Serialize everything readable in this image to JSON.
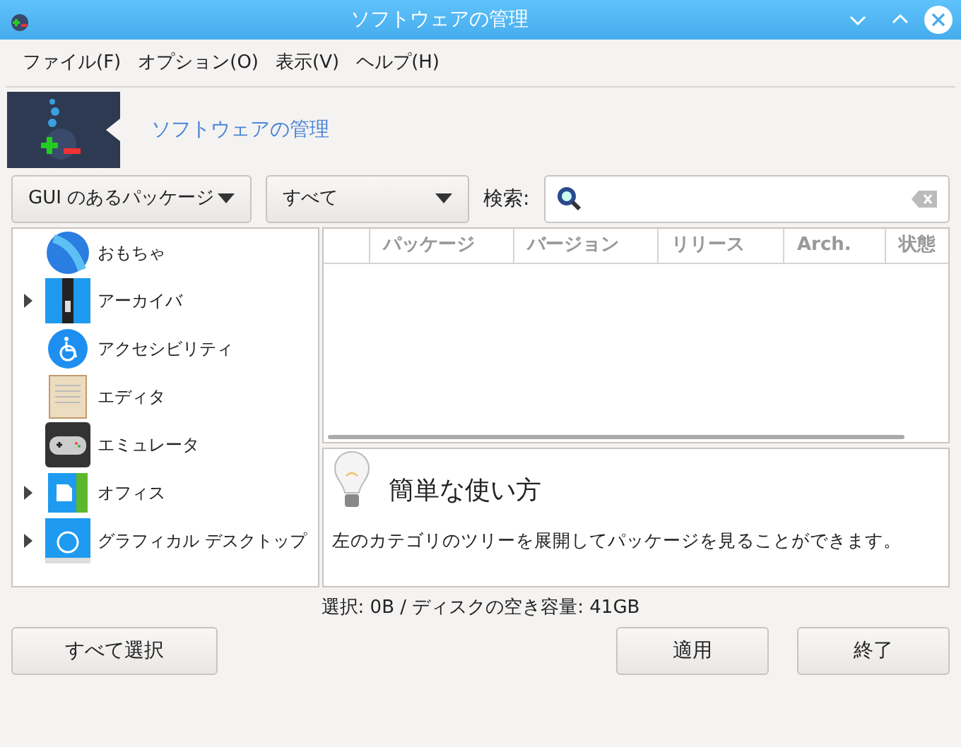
{
  "window": {
    "title": "ソフトウェアの管理"
  },
  "menu": [
    "ファイル(F)",
    "オプション(O)",
    "表示(V)",
    "ヘルプ(H)"
  ],
  "banner": {
    "title": "ソフトウェアの管理"
  },
  "filters": [
    {
      "label": "GUI のあるパッケージ"
    },
    {
      "label": "すべて"
    }
  ],
  "search": {
    "label": "検索:"
  },
  "categories": [
    {
      "name": "おもちゃ",
      "expandable": false,
      "kind": "ball"
    },
    {
      "name": "アーカイバ",
      "expandable": true,
      "kind": "zip"
    },
    {
      "name": "アクセシビリティ",
      "expandable": false,
      "kind": "access"
    },
    {
      "name": "エディタ",
      "expandable": false,
      "kind": "editor"
    },
    {
      "name": "エミュレータ",
      "expandable": false,
      "kind": "gamepad"
    },
    {
      "name": "オフィス",
      "expandable": true,
      "kind": "office"
    },
    {
      "name": "グラフィカル デスクトップ",
      "expandable": true,
      "kind": "desktop"
    }
  ],
  "table": {
    "columns": [
      "パッケージ",
      "バージョン",
      "リリース",
      "Arch.",
      "状態"
    ]
  },
  "help": {
    "title": "簡単な使い方",
    "text": "左のカテゴリのツリーを展開してパッケージを見ることができます。"
  },
  "status_bar": "選択: 0B / ディスクの空き容量: 41GB",
  "buttons": {
    "left": "すべて選択",
    "right": [
      "適用",
      "終了"
    ]
  }
}
